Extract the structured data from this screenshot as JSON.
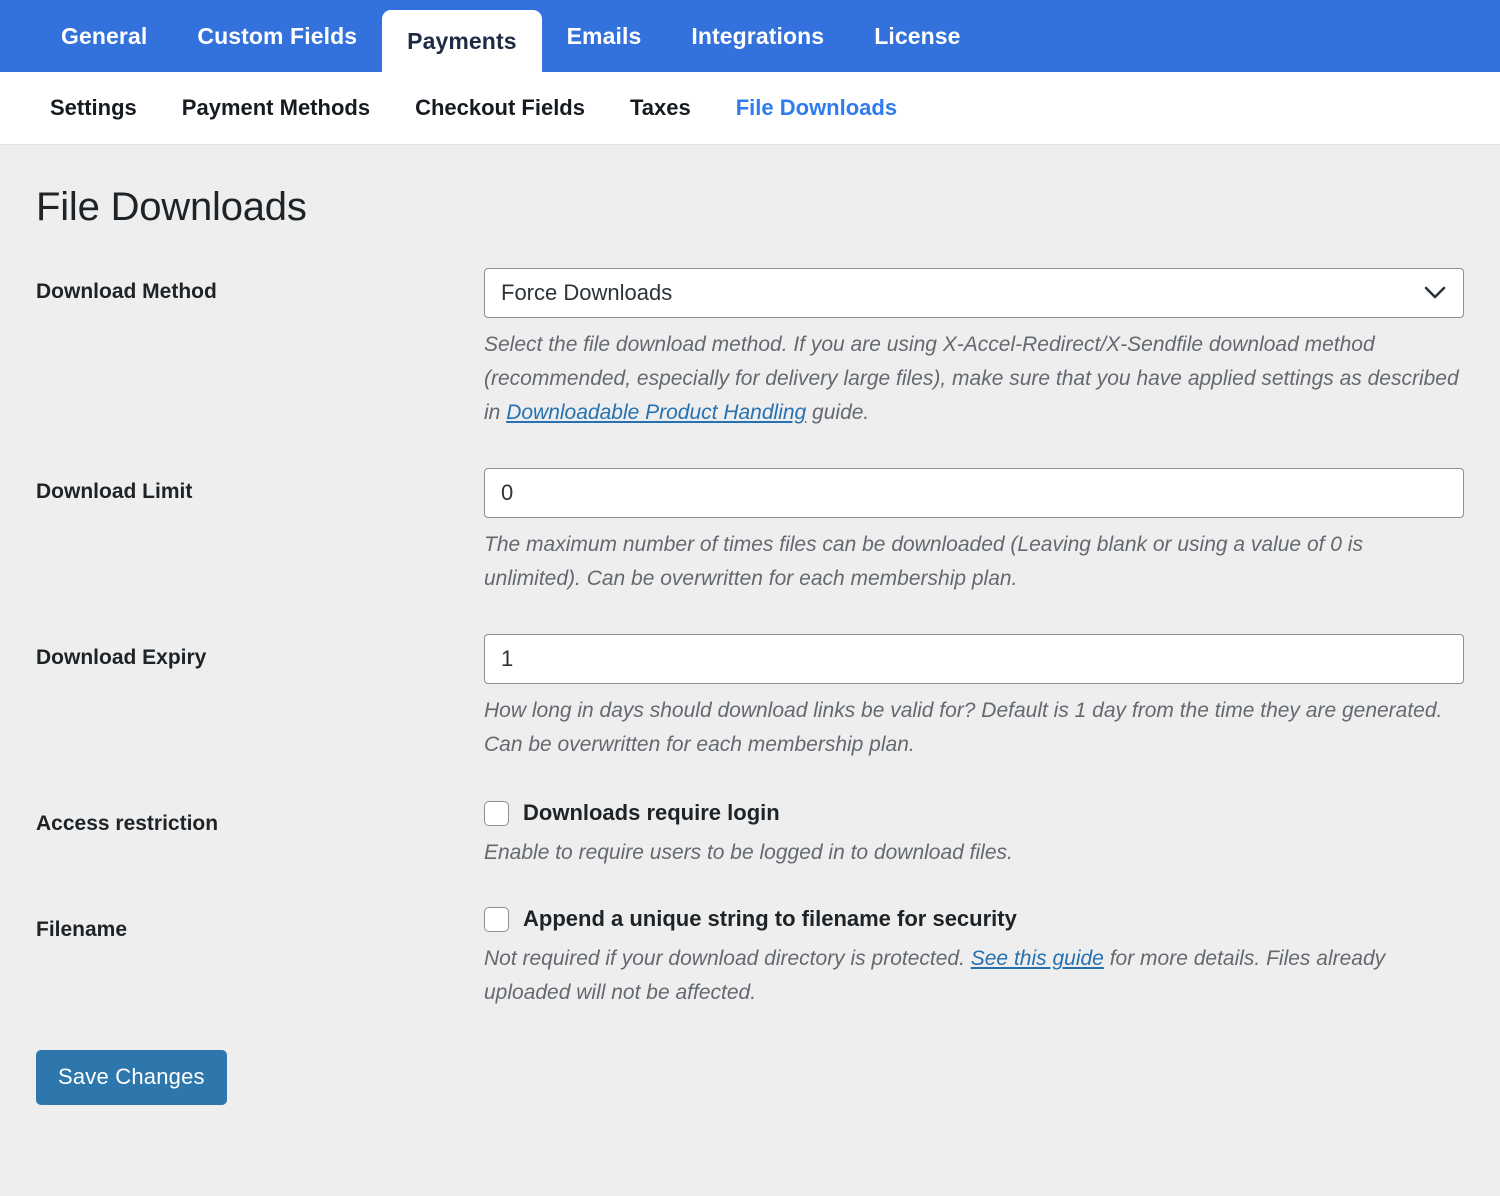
{
  "topnav": {
    "tabs": [
      {
        "label": "General",
        "active": false
      },
      {
        "label": "Custom Fields",
        "active": false
      },
      {
        "label": "Payments",
        "active": true
      },
      {
        "label": "Emails",
        "active": false
      },
      {
        "label": "Integrations",
        "active": false
      },
      {
        "label": "License",
        "active": false
      }
    ],
    "bar_color": "#3372dd",
    "active_tab_text_color": "#1f2b45"
  },
  "subnav": {
    "items": [
      {
        "label": "Settings",
        "active": false
      },
      {
        "label": "Payment Methods",
        "active": false
      },
      {
        "label": "Checkout Fields",
        "active": false
      },
      {
        "label": "Taxes",
        "active": false
      },
      {
        "label": "File Downloads",
        "active": true
      }
    ],
    "active_color": "#2f7bf0"
  },
  "page": {
    "title": "File Downloads"
  },
  "fields": {
    "download_method": {
      "label": "Download Method",
      "value": "Force Downloads",
      "desc_part1": "Select the file download method. If you are using X-Accel-Redirect/X-Sendfile download method (recommended, especially for delivery large files), make sure that you have applied settings as described in ",
      "link_text": "Downloadable Product Handling",
      "desc_part2": " guide."
    },
    "download_limit": {
      "label": "Download Limit",
      "value": "0",
      "desc": "The maximum number of times files can be downloaded (Leaving blank or using a value of 0 is unlimited). Can be overwritten for each membership plan."
    },
    "download_expiry": {
      "label": "Download Expiry",
      "value": "1",
      "desc": "How long in days should download links be valid for? Default is 1 day from the time they are generated. Can be overwritten for each membership plan."
    },
    "access_restriction": {
      "label": "Access restriction",
      "checkbox_label": "Downloads require login",
      "checked": false,
      "desc": "Enable to require users to be logged in to download files."
    },
    "filename": {
      "label": "Filename",
      "checkbox_label": "Append a unique string to filename for security",
      "checked": false,
      "desc_part1": "Not required if your download directory is protected. ",
      "link_text": "See this guide",
      "desc_part2": " for more details. Files already uploaded will not be affected."
    }
  },
  "footer": {
    "save_label": "Save Changes",
    "save_color": "#2e77ad"
  },
  "icons": {
    "chevron_down": "chevron-down-icon"
  }
}
